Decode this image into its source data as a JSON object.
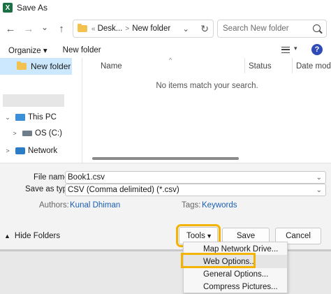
{
  "window": {
    "title": "Save As",
    "app_icon": "excel-icon",
    "app_icon_glyph": "X",
    "accent": "#f5b301"
  },
  "nav": {
    "back_glyph": "←",
    "forward_glyph": "→",
    "recent_glyph": "⌄",
    "up_glyph": "↑",
    "breadcrumb_prefix": "«",
    "breadcrumb": [
      "Desk...",
      "New folder"
    ],
    "breadcrumb_sep": ">",
    "chevron": "⌄",
    "refresh_glyph": "↻",
    "search_placeholder": "Search New folder"
  },
  "toolbar": {
    "organize": "Organize ▾",
    "new_folder": "New folder",
    "view_drop": "▾",
    "help": "?"
  },
  "sidebar": {
    "selected": "New folder",
    "items": [
      {
        "label": "This PC",
        "arrow": "⌄"
      },
      {
        "label": "OS (C:)",
        "arrow": ">"
      },
      {
        "label": "Network",
        "arrow": ">"
      }
    ]
  },
  "filepane": {
    "columns": [
      "Name",
      "Status",
      "Date modifi"
    ],
    "sort_caret": "^",
    "empty_message": "No items match your search."
  },
  "form": {
    "file_name_label": "File name:",
    "file_name_value": "Book1.csv",
    "save_type_label": "Save as type:",
    "save_type_value": "CSV (Comma delimited) (*.csv)",
    "dropdown_glyph": "⌄",
    "authors_label": "Authors:",
    "authors_value": "Kunal Dhiman",
    "tags_label": "Tags:",
    "tags_value": "Keywords"
  },
  "footer": {
    "hide_folders": "Hide Folders",
    "hide_caret": "▲",
    "tools": "Tools",
    "tools_drop": "▼",
    "save": "Save",
    "cancel": "Cancel"
  },
  "tools_menu": [
    "Map Network Drive...",
    "Web Options...",
    "General Options...",
    "Compress Pictures..."
  ]
}
